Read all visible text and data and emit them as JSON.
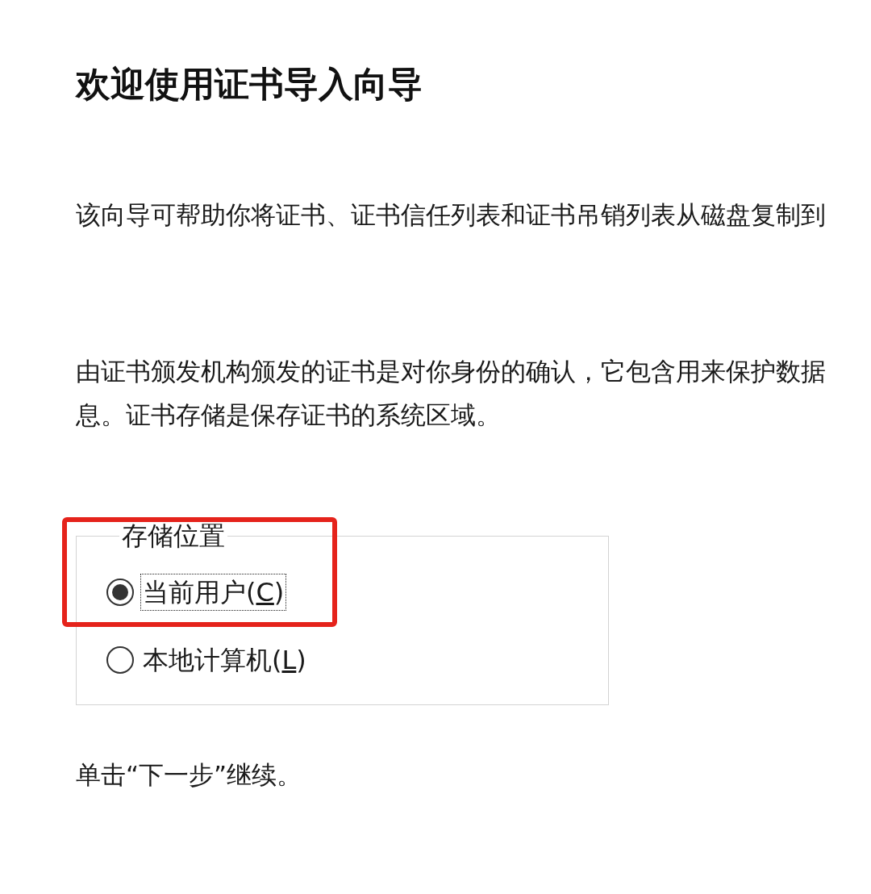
{
  "heading": "欢迎使用证书导入向导",
  "intro": "该向导可帮助你将证书、证书信任列表和证书吊销列表从磁盘复制到",
  "description": {
    "lines": [
      "由证书颁发机构颁发的证书是对你身份的确认，它包含用来保护数据",
      "息。证书存储是保存证书的系统区域。"
    ]
  },
  "store_location": {
    "legend": "存储位置",
    "options": [
      {
        "label": "当前用户(",
        "access_key": "C",
        "label_end": ")",
        "selected": true,
        "focused": true,
        "highlighted": true
      },
      {
        "label": "本地计算机(",
        "access_key": "L",
        "label_end": ")",
        "selected": false,
        "focused": false,
        "highlighted": false
      }
    ]
  },
  "footer": "单击“下一步”继续。"
}
